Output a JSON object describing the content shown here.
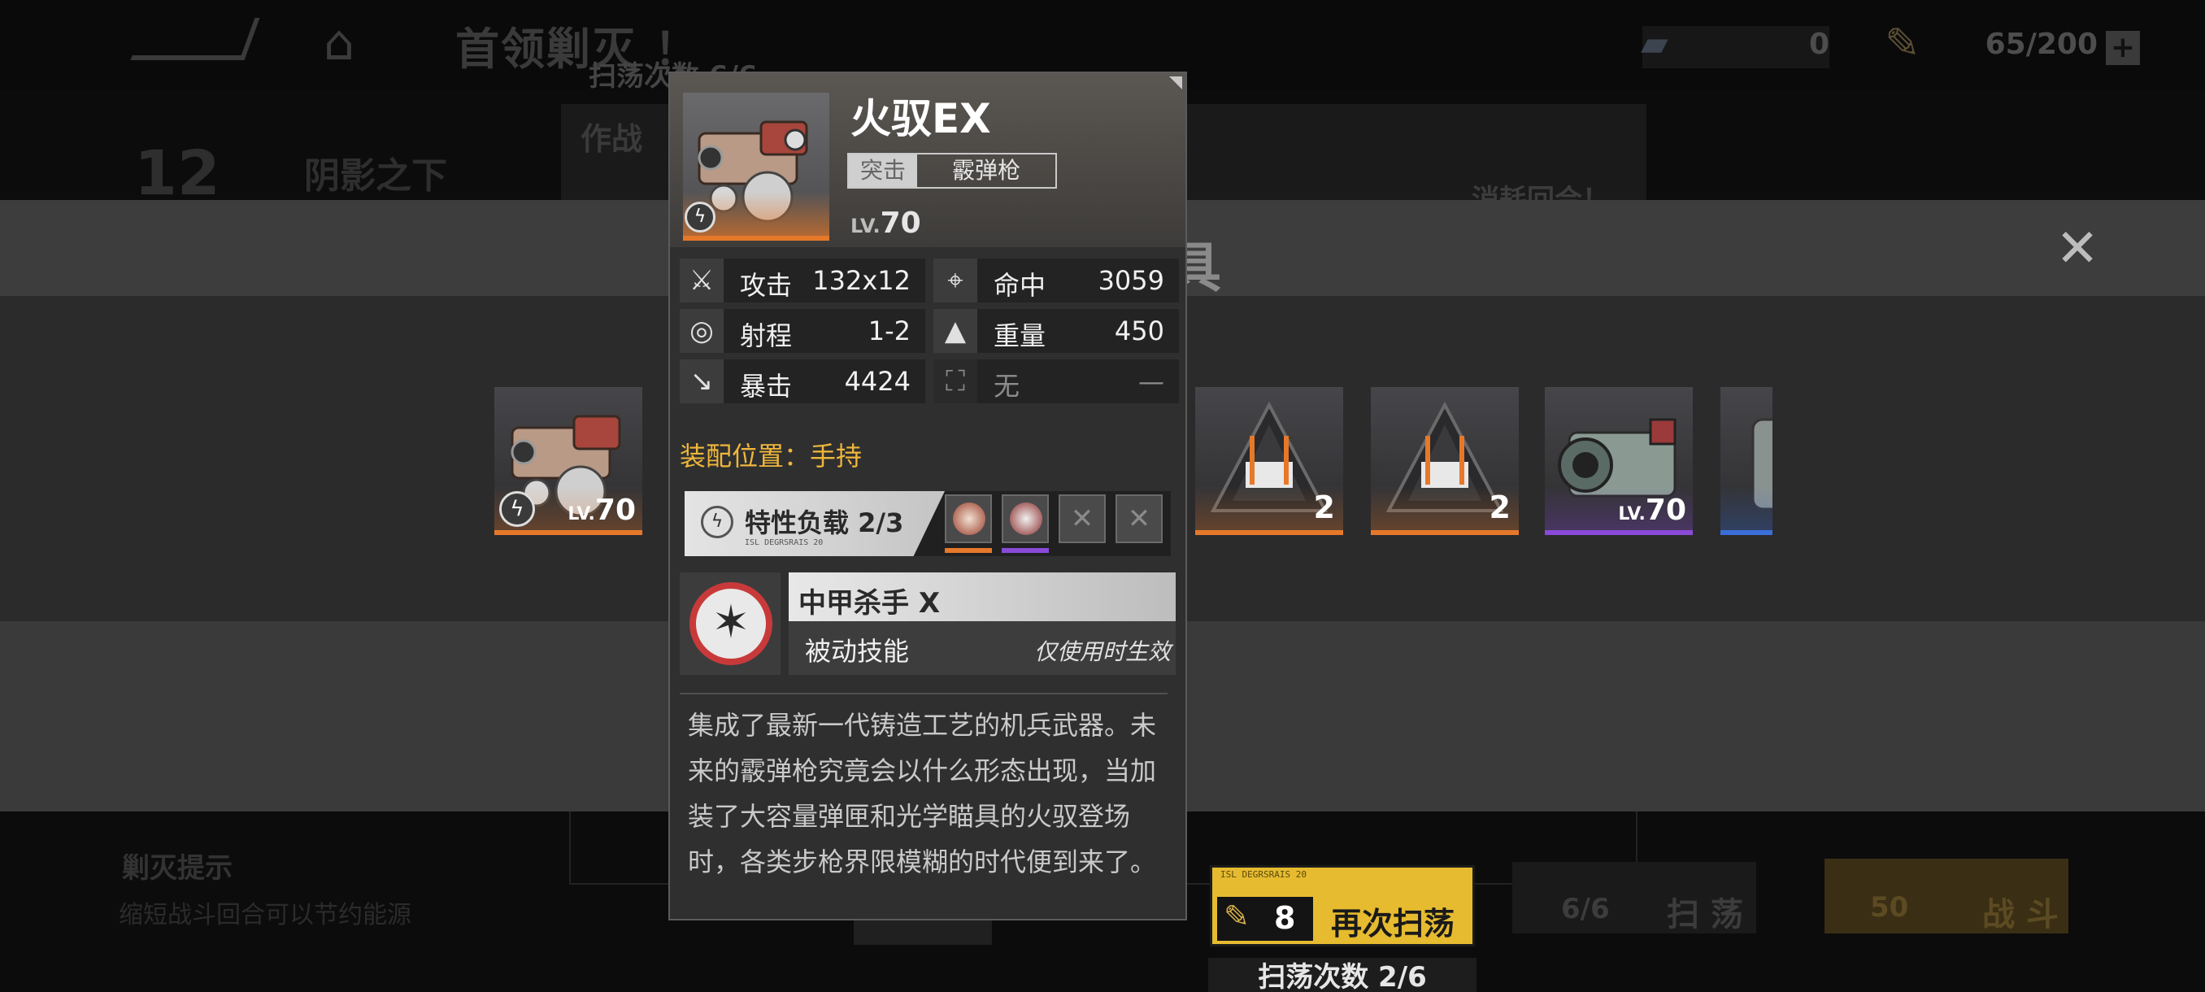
{
  "top_bar": {
    "title": "首领剿灭 ！",
    "sweep_count_bg": "扫荡次数 6/6",
    "resource1_value": "0",
    "resource2_value": "65/200",
    "resource2_plus": "+"
  },
  "stage": {
    "number": "12",
    "name": "阴影之下",
    "panel_label": "作战",
    "consume_label": "消耗回合！"
  },
  "background_bottom": {
    "hint_title": "剿灭提示",
    "hint_text": "缩短战斗回合可以节约能源",
    "sweep_count": "6/6",
    "sweep_label": "扫 荡",
    "battle_cost": "50",
    "battle_label": "战 斗"
  },
  "rewards_modal": {
    "title": "获得道具",
    "close_icon": "close-icon",
    "items": [
      {
        "kind": "weapon",
        "level_prefix": "LV.",
        "level": "70",
        "rarity_color": "#e6782a",
        "badge": "ϟ"
      },
      {
        "kind": "material",
        "quantity": "2",
        "rarity_color": "#e6782a"
      },
      {
        "kind": "material",
        "quantity": "2",
        "rarity_color": "#e6782a"
      },
      {
        "kind": "weapon",
        "level_prefix": "LV.",
        "level": "70",
        "rarity_color": "#8a4ad8"
      },
      {
        "kind": "part",
        "rarity_color": "#3a6ed8"
      }
    ],
    "sweep_again": {
      "cost": "8",
      "label": "再次扫荡",
      "micro_text": "ISL DEGRSRAIS          20"
    },
    "sweep_remaining": "扫荡次数 2/6"
  },
  "weapon_popup": {
    "name": "火驭EX",
    "tag_type": "突击",
    "tag_class": "霰弹枪",
    "level_prefix": "LV.",
    "level": "70",
    "stats": [
      {
        "icon": "swords-icon",
        "glyph": "⚔",
        "label": "攻击",
        "value": "132x12"
      },
      {
        "icon": "target-icon",
        "glyph": "⌖",
        "label": "命中",
        "value": "3059"
      },
      {
        "icon": "range-icon",
        "glyph": "◎",
        "label": "射程",
        "value": "1-2"
      },
      {
        "icon": "weight-icon",
        "glyph": "▲",
        "label": "重量",
        "value": "450"
      },
      {
        "icon": "crit-icon",
        "glyph": "↘",
        "label": "暴击",
        "value": "4424"
      },
      {
        "icon": "none-icon",
        "glyph": "⛶",
        "label": "无",
        "value": "—"
      }
    ],
    "equip_position": "装配位置：手持",
    "trait_load": {
      "label": "特性负载 2/3",
      "micro": "ISL DEGRSRAIS 20"
    },
    "skill": {
      "name": "中甲杀手 X",
      "type": "被动技能",
      "note": "仅使用时生效"
    },
    "description": "集成了最新一代铸造工艺的机兵武器。未来的霰弹枪究竟会以什么形态出现，当加装了大容量弹匣和光学瞄具的火驭登场时，各类步枪界限模糊的时代便到来了。"
  },
  "colors": {
    "accent_gold": "#e6bb2f",
    "rarity_orange": "#e6782a",
    "rarity_purple": "#8a4ad8",
    "skill_red": "#c83a3a",
    "equip_text": "#efb73a"
  }
}
